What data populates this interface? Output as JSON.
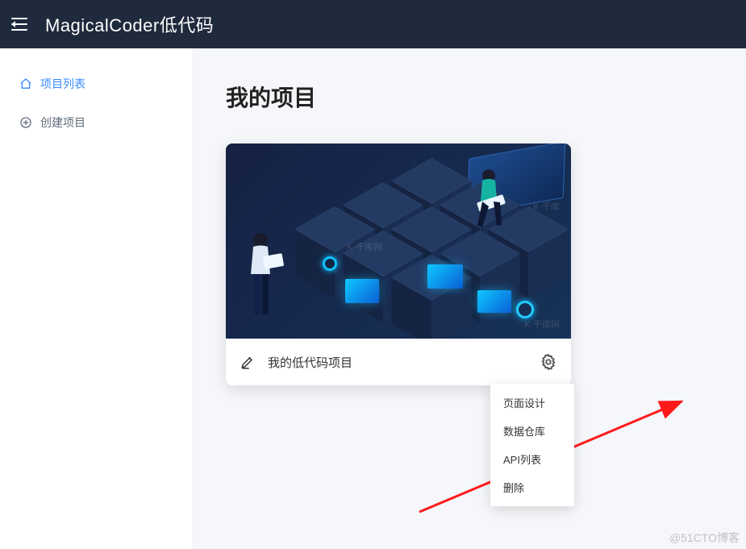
{
  "header": {
    "brand": "MagicalCoder低代码"
  },
  "sidebar": {
    "items": [
      {
        "label": "项目列表",
        "active": true
      },
      {
        "label": "创建项目",
        "active": false
      }
    ]
  },
  "main": {
    "page_title": "我的项目",
    "project": {
      "title": "我的低代码项目"
    },
    "settings_menu": [
      "页面设计",
      "数据仓库",
      "API列表",
      "删除"
    ]
  },
  "watermark": "@51CTO博客"
}
